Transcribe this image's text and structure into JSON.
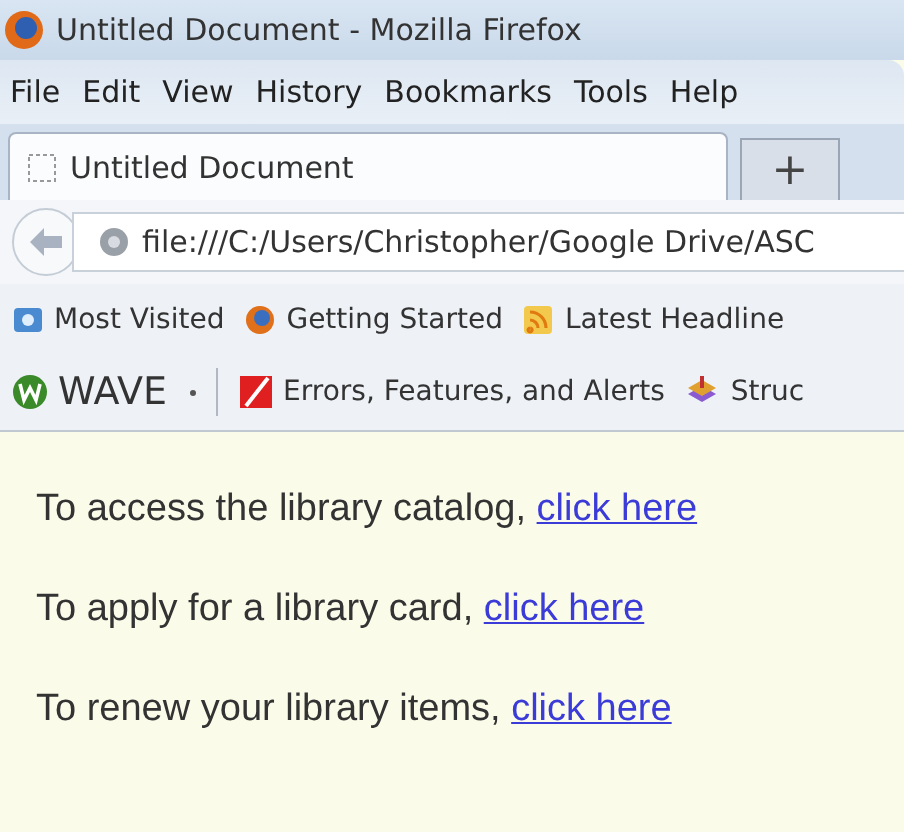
{
  "window": {
    "title": "Untitled Document - Mozilla Firefox"
  },
  "menu": [
    {
      "label": "File"
    },
    {
      "label": "Edit"
    },
    {
      "label": "View"
    },
    {
      "label": "History"
    },
    {
      "label": "Bookmarks"
    },
    {
      "label": "Tools"
    },
    {
      "label": "Help"
    }
  ],
  "tabs": [
    {
      "label": "Untitled Document",
      "selected": true
    }
  ],
  "new_tab": "+",
  "address_bar": {
    "value": "file:///C:/Users/Christopher/Google Drive/ASC"
  },
  "bookmarks": [
    {
      "label": "Most Visited",
      "kind": "folder"
    },
    {
      "label": "Getting Started",
      "kind": "firefox"
    },
    {
      "label": "Latest Headline",
      "kind": "feed"
    }
  ],
  "wave_toolbar": [
    {
      "label": "WAVE",
      "kind": "wave"
    },
    {
      "label": "Errors, Features, and Alerts",
      "kind": "errors"
    },
    {
      "label": "Struc",
      "kind": "structure"
    }
  ],
  "content": [
    {
      "text": "To access the library catalog, ",
      "link": "click here"
    },
    {
      "text": "To apply for a library card, ",
      "link": "click here"
    },
    {
      "text": "To renew your library items, ",
      "link": "click here"
    }
  ]
}
